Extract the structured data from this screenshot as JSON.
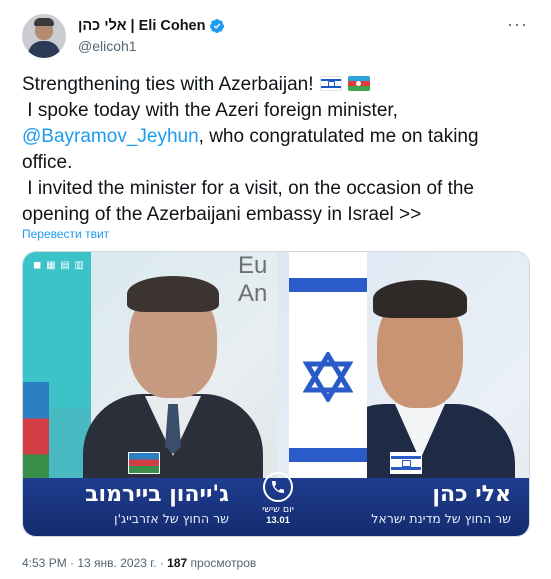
{
  "author": {
    "display_name": "אלי כהן | Eli Cohen",
    "handle": "@elicoh1",
    "verified": true
  },
  "more_button": "···",
  "tweet": {
    "line1": "Strengthening ties with Azerbaijan!",
    "line2": " I spoke today with the Azeri foreign minister,",
    "mention": "@Bayramov_Jeyhun",
    "line3_rest": ", who congratulated me on taking",
    "line4": "office.",
    "line5": " I invited the minister for a visit, on the occasion of the",
    "line6": "opening of the Azerbaijani embassy in Israel >>",
    "flags": [
      "flag-israel-icon",
      "flag-azerbaijan-icon"
    ]
  },
  "translate_label": "Перевести твит",
  "media": {
    "wall_text": "Eu\nAn",
    "left_caption": {
      "name": "ג'ייהון ביירמוב",
      "title": "שר החוץ של אזרבייג'ן"
    },
    "right_caption": {
      "name": "אלי כהן",
      "title": "שר החוץ של מדינת ישראל"
    },
    "center_badge": {
      "day": "יום שישי",
      "date": "13.01"
    }
  },
  "meta": {
    "time": "4:53 PM",
    "date": "13 янв. 2023 г.",
    "views_count": "187",
    "views_label": "просмотров"
  },
  "colors": {
    "accent": "#1d9bf0",
    "caption_bar": "#1f3d8f"
  }
}
